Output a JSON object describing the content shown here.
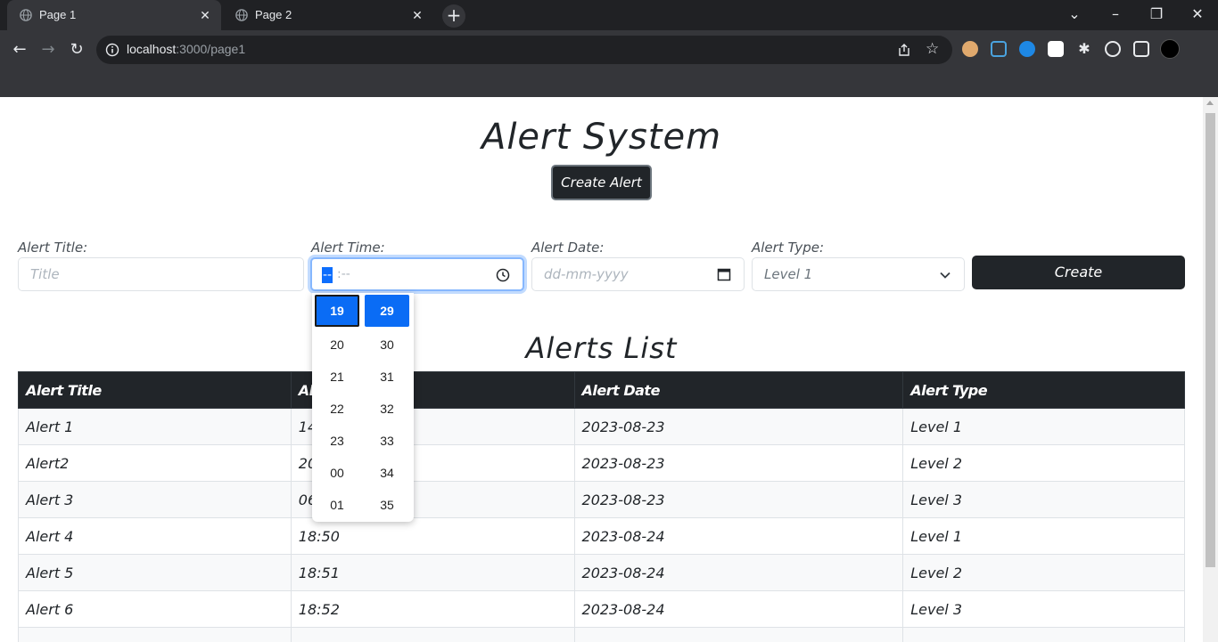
{
  "browser": {
    "tabs": [
      {
        "title": "Page 1",
        "active": true
      },
      {
        "title": "Page 2",
        "active": false
      }
    ],
    "url_host": "localhost",
    "url_rest": ":3000/page1"
  },
  "app": {
    "title": "Alert System",
    "create_alert_label": "Create Alert"
  },
  "form": {
    "title_label": "Alert Title:",
    "title_placeholder": "Title",
    "time_label": "Alert Time:",
    "time_hour_segment": "--",
    "time_rest": ":--",
    "date_label": "Alert Date:",
    "date_placeholder": "dd-mm-yyyy",
    "type_label": "Alert Type:",
    "type_value": "Level 1",
    "create_label": "Create"
  },
  "time_picker": {
    "hours": [
      "19",
      "20",
      "21",
      "22",
      "23",
      "00",
      "01"
    ],
    "minutes": [
      "29",
      "30",
      "31",
      "32",
      "33",
      "34",
      "35"
    ],
    "selected_hour": "19",
    "selected_minute": "29"
  },
  "list": {
    "title": "Alerts List",
    "headers": [
      "Alert Title",
      "Alert Time",
      "Alert Date",
      "Alert Type"
    ],
    "rows": [
      [
        "Alert 1",
        "14",
        "2023-08-23",
        "Level 1"
      ],
      [
        "Alert2",
        "20",
        "2023-08-23",
        "Level 2"
      ],
      [
        "Alert 3",
        "06",
        "2023-08-23",
        "Level 3"
      ],
      [
        "Alert 4",
        "18:50",
        "2023-08-24",
        "Level 1"
      ],
      [
        "Alert 5",
        "18:51",
        "2023-08-24",
        "Level 2"
      ],
      [
        "Alert 6",
        "18:52",
        "2023-08-24",
        "Level 3"
      ]
    ]
  }
}
